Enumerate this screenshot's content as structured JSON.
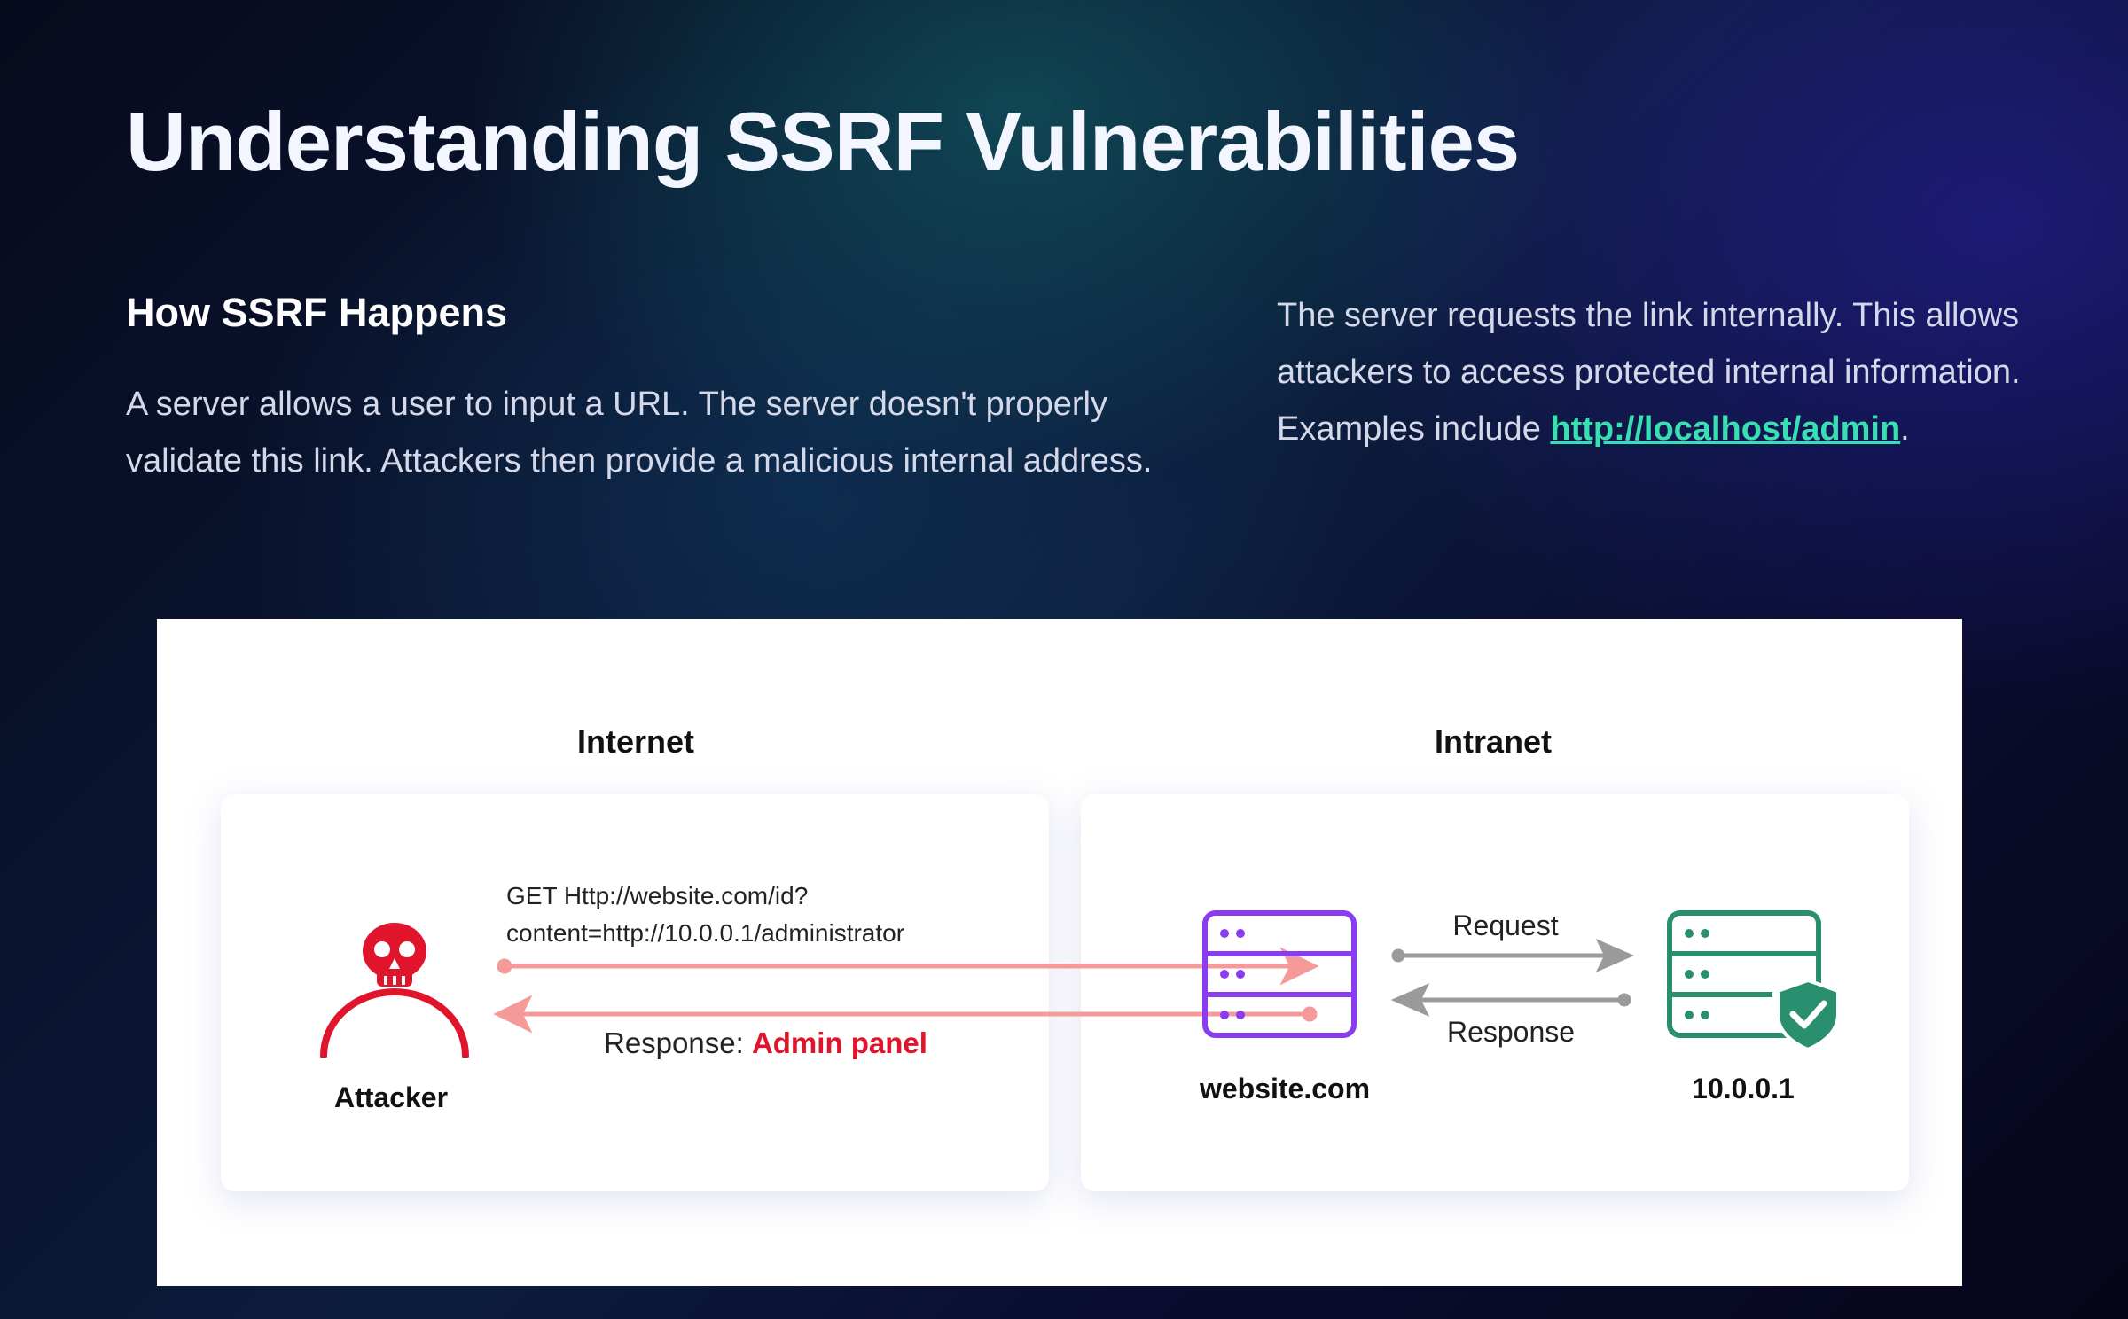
{
  "slide": {
    "title": "Understanding SSRF Vulnerabilities",
    "subtitle": "How SSRF Happens",
    "left_paragraph": "A server allows a user to input a URL. The server doesn't properly validate this link. Attackers then provide a malicious internal address.",
    "right_paragraph_text": "The server requests the link internally. This allows attackers to access protected internal information. Examples include",
    "right_paragraph_link": "http://localhost/admin",
    "right_paragraph_end": "."
  },
  "diagram": {
    "internet_label": "Internet",
    "intranet_label": "Intranet",
    "attacker_label": "Attacker",
    "request_line1": "GET Http://website.com/id?",
    "request_line2": "content=http://10.0.0.1/administrator",
    "response_prefix": "Response: ",
    "response_highlight": "Admin panel",
    "website_label": "website.com",
    "internal_label": "10.0.0.1",
    "request_label": "Request",
    "response_label": "Response"
  },
  "icons": [
    "skull-icon",
    "server-icon",
    "secure-server-icon",
    "shield-check-icon"
  ],
  "colors": {
    "link": "#37e0b0",
    "attacker_red": "#e0142b",
    "website_purple": "#8a3cf0",
    "internal_green": "#2a8f6e",
    "request_arrow": "#f59a98",
    "intranet_arrow": "#9a9a9a"
  }
}
